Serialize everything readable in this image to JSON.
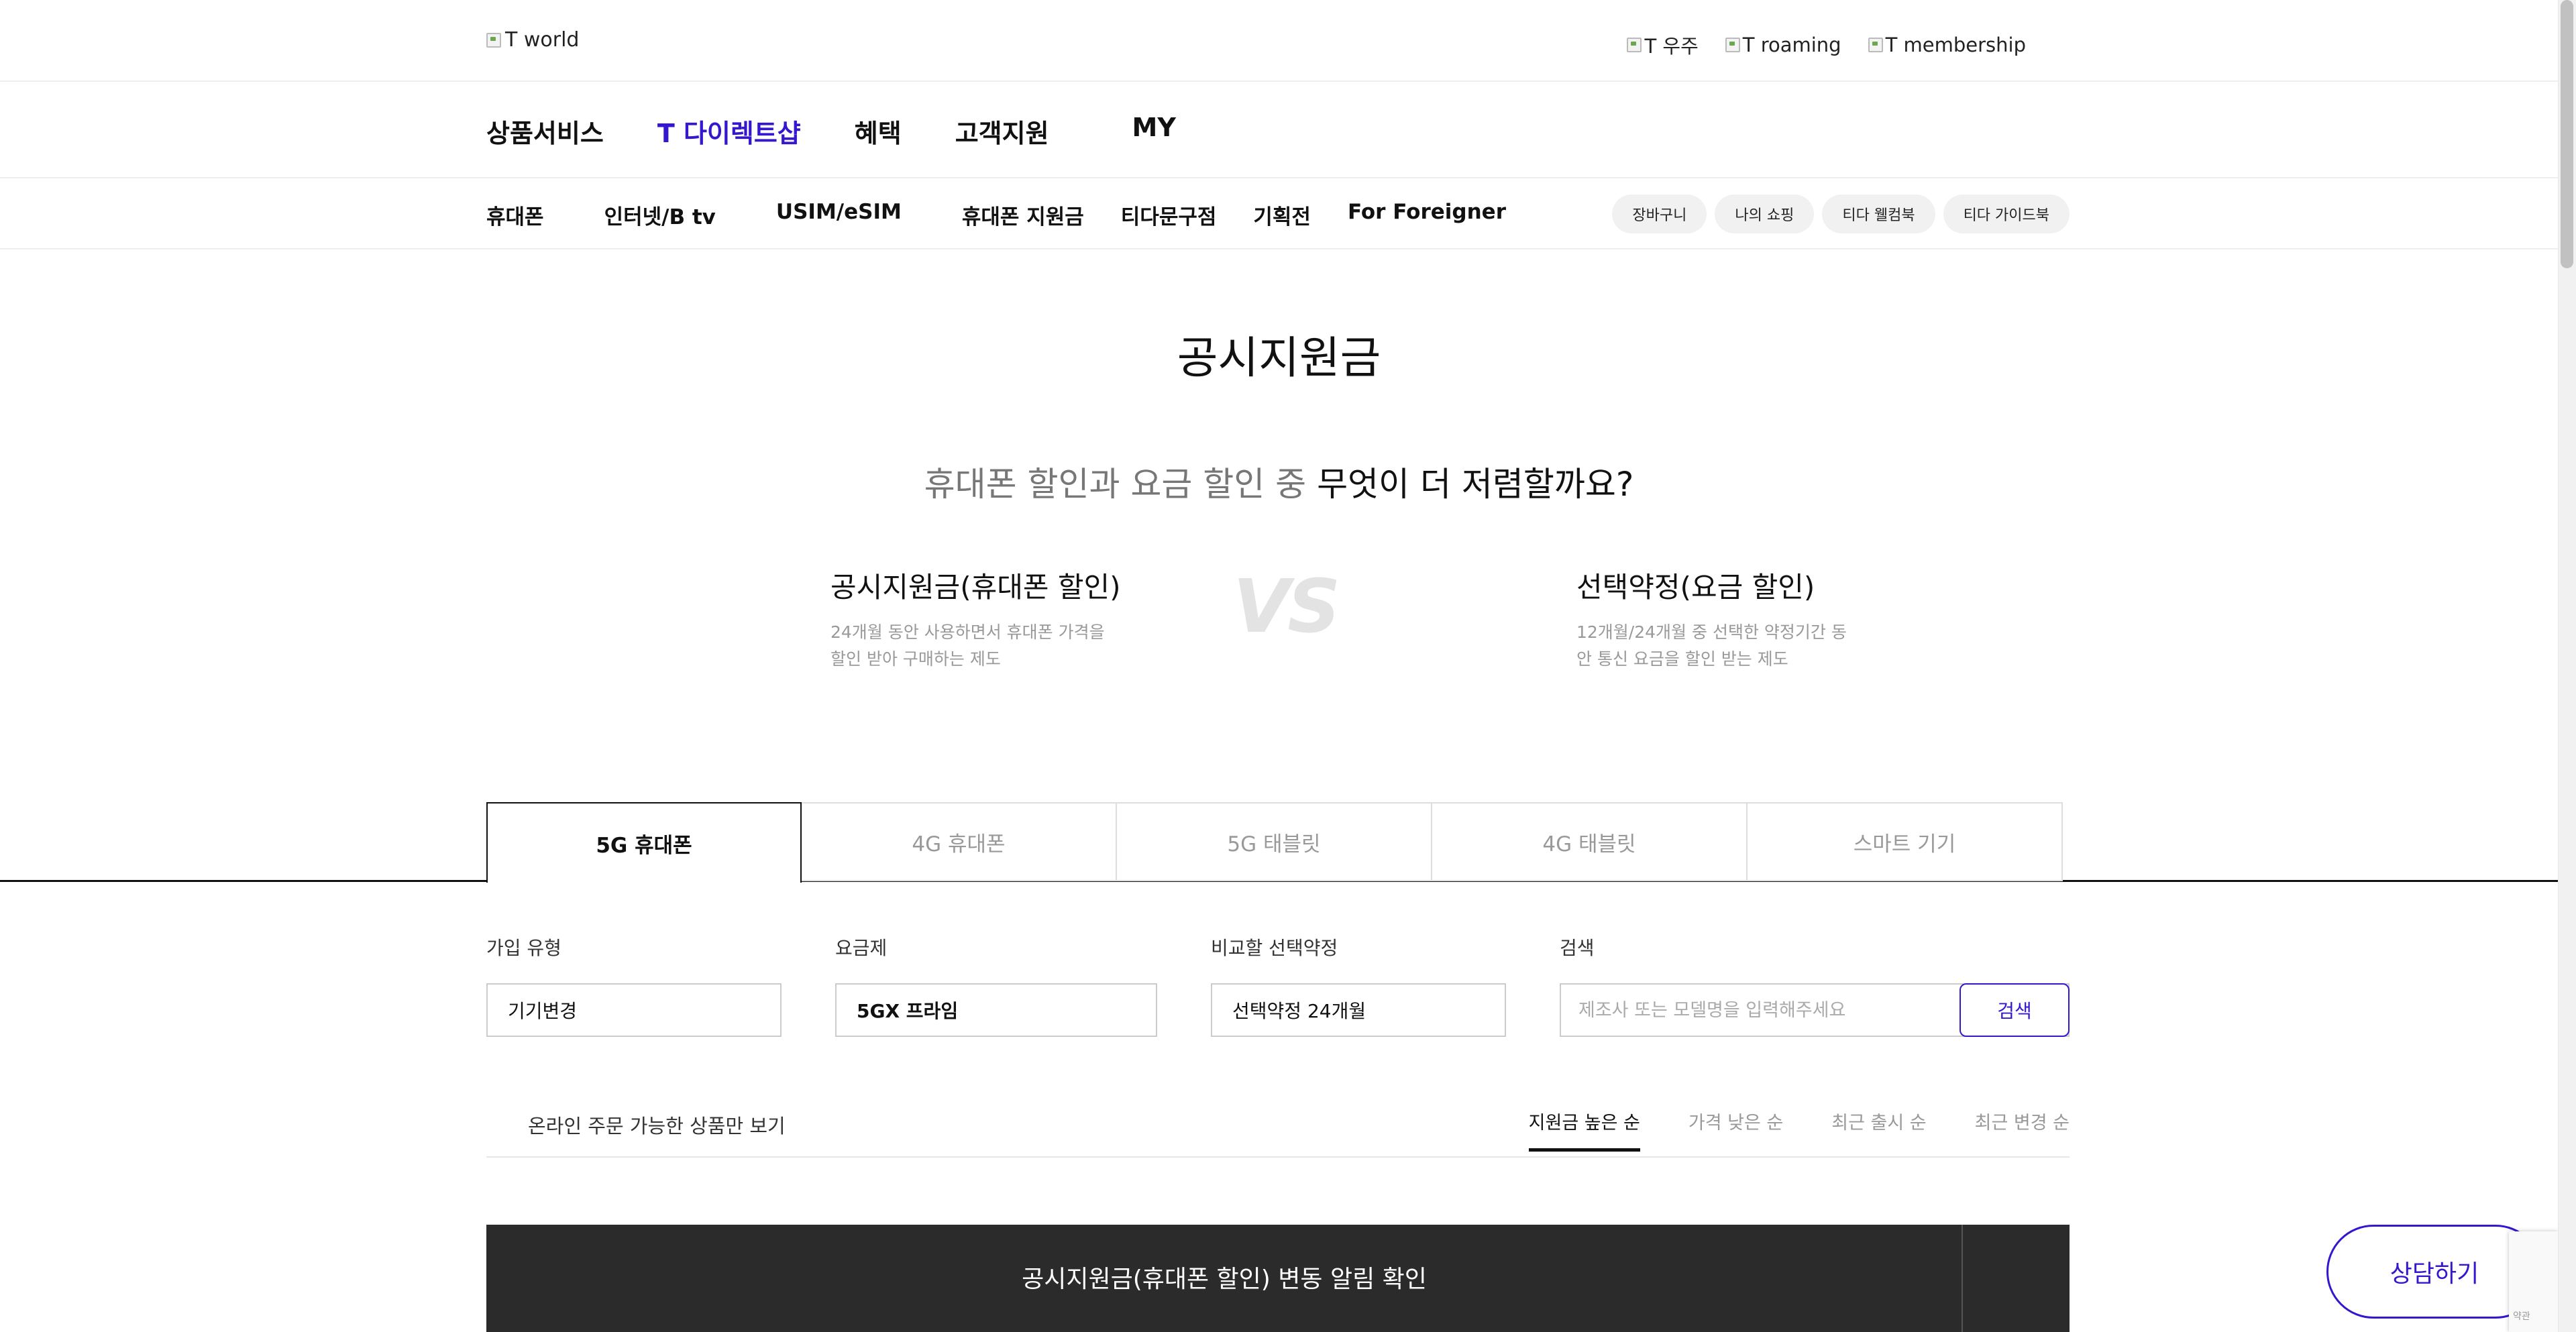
{
  "header": {
    "logo_alt": "T world",
    "util_links": [
      "T 우주",
      "T roaming",
      "T membership"
    ]
  },
  "gnb": {
    "items": [
      "상품서비스",
      "T 다이렉트샵",
      "혜택",
      "고객지원",
      "MY"
    ],
    "accent_color": "#3617ce"
  },
  "subnav": {
    "items": [
      "휴대폰",
      "인터넷/B tv",
      "USIM/eSIM",
      "휴대폰 지원금",
      "티다문구점",
      "기획전",
      "For Foreigner"
    ],
    "pills": [
      "장바구니",
      "나의 쇼핑",
      "티다 웰컴북",
      "티다 가이드북"
    ]
  },
  "hero": {
    "title": "공시지원금",
    "question_gray": "휴대폰 할인과 요금 할인 중 ",
    "question_dark": "무엇이 더 저렴할까요?",
    "left_title": "공시지원금(휴대폰 할인)",
    "left_desc": "24개월 동안 사용하면서 휴대폰 가격을 할인 받아 구매하는 제도",
    "vs": "VS",
    "right_title": "선택약정(요금 할인)",
    "right_desc": "12개월/24개월 중 선택한 약정기간 동안 통신 요금을 할인 받는 제도"
  },
  "tabs": [
    "5G 휴대폰",
    "4G 휴대폰",
    "5G 태블릿",
    "4G 태블릿",
    "스마트 기기"
  ],
  "filters": {
    "join_type_label": "가입 유형",
    "join_type_value": "기기변경",
    "plan_label": "요금제",
    "plan_value": "5GX 프라임",
    "contract_label": "비교할 선택약정",
    "contract_value": "선택약정 24개월",
    "search_label": "검색",
    "search_placeholder": "제조사 또는 모델명을 입력해주세요",
    "search_button": "검색"
  },
  "list_options": {
    "online_only": "온라인 주문 가능한 상품만 보기",
    "sorts": [
      "지원금 높은 순",
      "가격 낮은 순",
      "최근 출시 순",
      "최근 변경 순"
    ]
  },
  "banner": {
    "text": "공시지원금(휴대폰 할인) 변동 알림 확인"
  },
  "floating": {
    "consult": "상담하기"
  }
}
